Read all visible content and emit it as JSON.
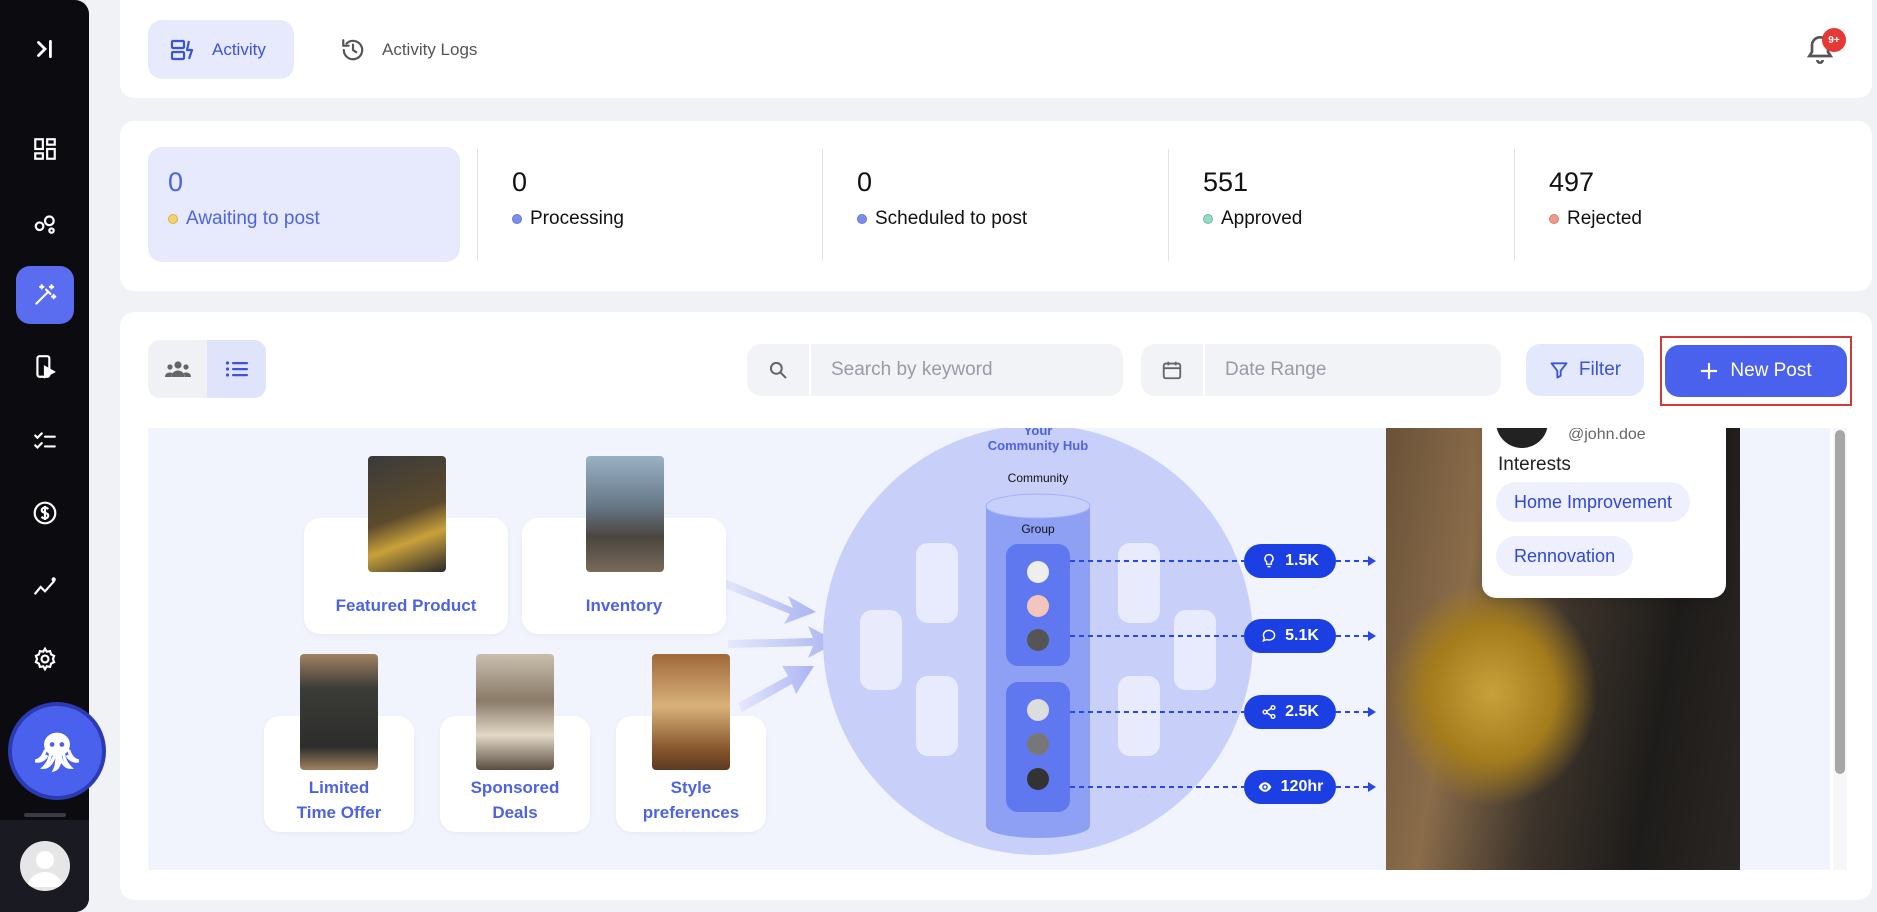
{
  "sidebar": {
    "items": [
      {
        "icon": "collapse-sidebar-icon"
      },
      {
        "icon": "dashboard-icon"
      },
      {
        "icon": "community-icon"
      },
      {
        "icon": "magic-wand-icon",
        "active": true
      },
      {
        "icon": "mobile-play-icon"
      },
      {
        "icon": "checklist-icon"
      },
      {
        "icon": "dollar-icon"
      },
      {
        "icon": "analytics-icon"
      },
      {
        "icon": "settings-icon"
      }
    ],
    "bot_icon": "octopus-icon",
    "avatar_icon": "user-avatar-icon"
  },
  "header": {
    "tabs": [
      {
        "label": "Activity",
        "active": true,
        "icon": "activity-icon"
      },
      {
        "label": "Activity Logs",
        "active": false,
        "icon": "history-icon"
      }
    ],
    "notification_badge": "9+"
  },
  "stats": [
    {
      "value": "0",
      "label": "Awaiting to post",
      "dot": "#f5d26b",
      "active": true
    },
    {
      "value": "0",
      "label": "Processing",
      "dot": "#7b8cf3",
      "active": false
    },
    {
      "value": "0",
      "label": "Scheduled to post",
      "dot": "#7b8cf3",
      "active": false
    },
    {
      "value": "551",
      "label": "Approved",
      "dot": "#8fd9c5",
      "active": false
    },
    {
      "value": "497",
      "label": "Rejected",
      "dot": "#f29a87",
      "active": false
    }
  ],
  "toolbar": {
    "search_placeholder": "Search by keyword",
    "date_placeholder": "Date Range",
    "filter_label": "Filter",
    "new_post_label": "New Post"
  },
  "illustration": {
    "tiles": {
      "featured": "Featured Product",
      "inventory": "Inventory",
      "limited_1": "Limited",
      "limited_2": "Time Offer",
      "sponsored_1": "Sponsored",
      "sponsored_2": "Deals",
      "style_1": "Style",
      "style_2": "preferences"
    },
    "hub_title_1": "Your",
    "hub_title_2": "Community Hub",
    "community_label": "Community",
    "group_label": "Group",
    "metrics": [
      {
        "icon": "lightbulb-icon",
        "value": "1.5K"
      },
      {
        "icon": "comment-icon",
        "value": "5.1K"
      },
      {
        "icon": "share-icon",
        "value": "2.5K"
      },
      {
        "icon": "eye-icon",
        "value": "120hr"
      }
    ],
    "profile": {
      "handle": "@john.doe",
      "interests_title": "Interests",
      "interests": [
        "Home Improvement",
        "Rennovation"
      ]
    }
  },
  "colors": {
    "accent": "#4a61ee",
    "accent_light": "#e6eafc",
    "sidebar_bg": "#0c0c10",
    "pill": "#1b3fe3"
  }
}
